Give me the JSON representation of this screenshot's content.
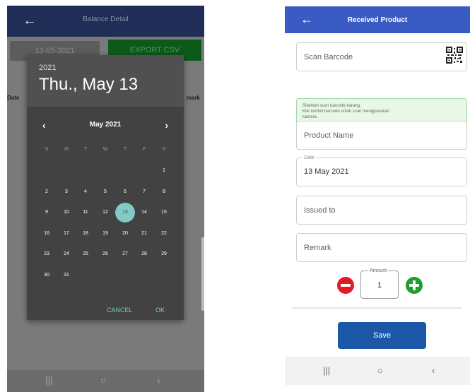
{
  "left_screen": {
    "header": {
      "back_icon": "arrow-left-icon",
      "title": "Balance Detail"
    },
    "date_button": "13-05-2021",
    "export_button": "EXPORT CSV",
    "columns": {
      "left": "Date",
      "right": "mark"
    },
    "date_picker": {
      "year": "2021",
      "selected_date": "Thu., May 13",
      "month_label": "May 2021",
      "prev_icon": "chevron-left-icon",
      "next_icon": "chevron-right-icon",
      "weekdays": [
        "S",
        "M",
        "T",
        "W",
        "T",
        "F",
        "S"
      ],
      "first_weekday_index": 6,
      "days": [
        "1",
        "2",
        "3",
        "4",
        "5",
        "6",
        "7",
        "8",
        "9",
        "10",
        "11",
        "12",
        "13",
        "14",
        "15",
        "16",
        "17",
        "18",
        "19",
        "20",
        "21",
        "22",
        "23",
        "24",
        "25",
        "26",
        "27",
        "28",
        "29",
        "30",
        "31"
      ],
      "selected_day": "13",
      "accent_color": "#80cbc4",
      "cancel_label": "CANCEL",
      "ok_label": "OK"
    },
    "navbar": {
      "recents": "|||",
      "home": "○",
      "back": "‹"
    }
  },
  "right_screen": {
    "header": {
      "back_icon": "arrow-left-icon",
      "title": "Received Product",
      "color": "#3b5bc4"
    },
    "scan_barcode": {
      "placeholder": "Scan Barcode",
      "icon": "qr-code-icon"
    },
    "info_text": [
      "Silahkan scan barcode barang.",
      "Klik tombol barcode untuk scan menggunakan",
      "kamera."
    ],
    "product_name": {
      "placeholder": "Product Name"
    },
    "date_field": {
      "label": "Date",
      "value": "13 May 2021"
    },
    "issued_to": {
      "placeholder": "Issued to"
    },
    "remark": {
      "placeholder": "Remark"
    },
    "amount": {
      "label": "Amount",
      "value": "1",
      "minus_icon": "minus-circle-icon",
      "plus_icon": "plus-circle-icon"
    },
    "save_button": "Save",
    "navbar": {
      "recents": "|||",
      "home": "○",
      "back": "‹"
    }
  }
}
